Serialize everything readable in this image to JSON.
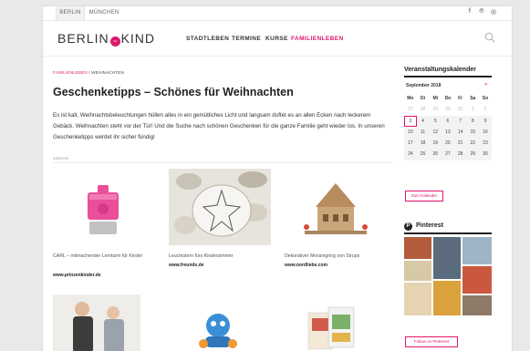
{
  "topbar": {
    "cities": [
      "BERLIN",
      "MÜNCHEN"
    ],
    "active_city": "BERLIN",
    "social_icons": [
      "facebook-icon",
      "pinterest-icon",
      "instagram-icon"
    ],
    "social_glyphs": [
      "f",
      "℗",
      "◎"
    ]
  },
  "header": {
    "logo_left": "BERLIN",
    "logo_badge": "mit",
    "logo_right": "KIND",
    "nav": [
      "STADTLEBEN",
      "TERMINE",
      "KURSE",
      "FAMILIENLEBEN"
    ],
    "active_nav": "FAMILIENLEBEN"
  },
  "article": {
    "breadcrumb_section": "FAMILIENLEBEN",
    "breadcrumb_sep": " / ",
    "breadcrumb_page": "WEIHNACHTEN",
    "title": "Geschenketipps – Schönes für Weihnachten",
    "intro": "Es ist kalt, Weihnachtsbeleuchtungen hüllen alles in ein gemütliches Licht und langsam duftet es an allen Ecken nach leckerem Gebäck. Weihnachten steht vor der Tür! Und die Suche nach schönen Geschenken für die ganze Familie geht wieder los. In unseren Geschenketipps werdet ihr sicher fündig!",
    "meta": "ANZEIGE"
  },
  "products": [
    {
      "caption": "CARL – mitmachender Lernturm für Kinder",
      "source": "www.prinzenkinder.de"
    },
    {
      "caption": "Leuchtstern fürs Kinderzimmer",
      "source": "www.freunds.de"
    },
    {
      "caption": "Dekorativer Messingring von Strups",
      "source": "www.nordliebe.com"
    }
  ],
  "sidebar": {
    "calendar_title": "Veranstaltungskalender",
    "month": "September 2018",
    "next_arrow": "»",
    "weekdays": [
      "Mo",
      "Di",
      "Mi",
      "Do",
      "Fr",
      "Sa",
      "So"
    ],
    "weeks": [
      [
        "27",
        "28",
        "29",
        "30",
        "31",
        "1",
        "2"
      ],
      [
        "3",
        "4",
        "5",
        "6",
        "7",
        "8",
        "9"
      ],
      [
        "10",
        "11",
        "12",
        "13",
        "14",
        "15",
        "16"
      ],
      [
        "17",
        "18",
        "19",
        "20",
        "21",
        "22",
        "23"
      ],
      [
        "24",
        "25",
        "26",
        "27",
        "28",
        "29",
        "30"
      ]
    ],
    "today": "3",
    "calendar_button": "Zum Kalender",
    "pinterest_title": "Pinterest",
    "pinterest_glyph": "P",
    "pinterest_button": "Follow on Pinterest"
  },
  "colors": {
    "accent": "#e0166e",
    "text": "#222222",
    "muted": "#999999"
  }
}
